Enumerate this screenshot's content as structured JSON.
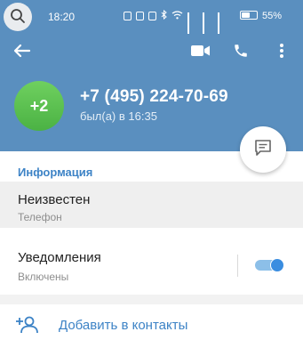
{
  "status_bar": {
    "time": "18:20",
    "battery": "55%",
    "battery_level": 0.55
  },
  "action_bar": {
    "back_icon": "arrow-left-icon",
    "video_icon": "video-camera-icon",
    "call_icon": "phone-icon",
    "more_icon": "more-vertical-icon"
  },
  "profile": {
    "avatar_text": "+2",
    "phone": "+7 (495) 224-70-69",
    "last_seen": "был(а) в 16:35",
    "avatar_color": "#5ec24f",
    "header_color": "#5a8fbf"
  },
  "info": {
    "section_title": "Информация",
    "value": "Неизвестен",
    "label": "Телефон"
  },
  "notifications": {
    "title": "Уведомления",
    "subtitle": "Включены",
    "enabled": true
  },
  "add_contact": {
    "label": "Добавить в контакты"
  },
  "colors": {
    "accent": "#3d83c6",
    "toggle_on": "#3a8de0"
  }
}
